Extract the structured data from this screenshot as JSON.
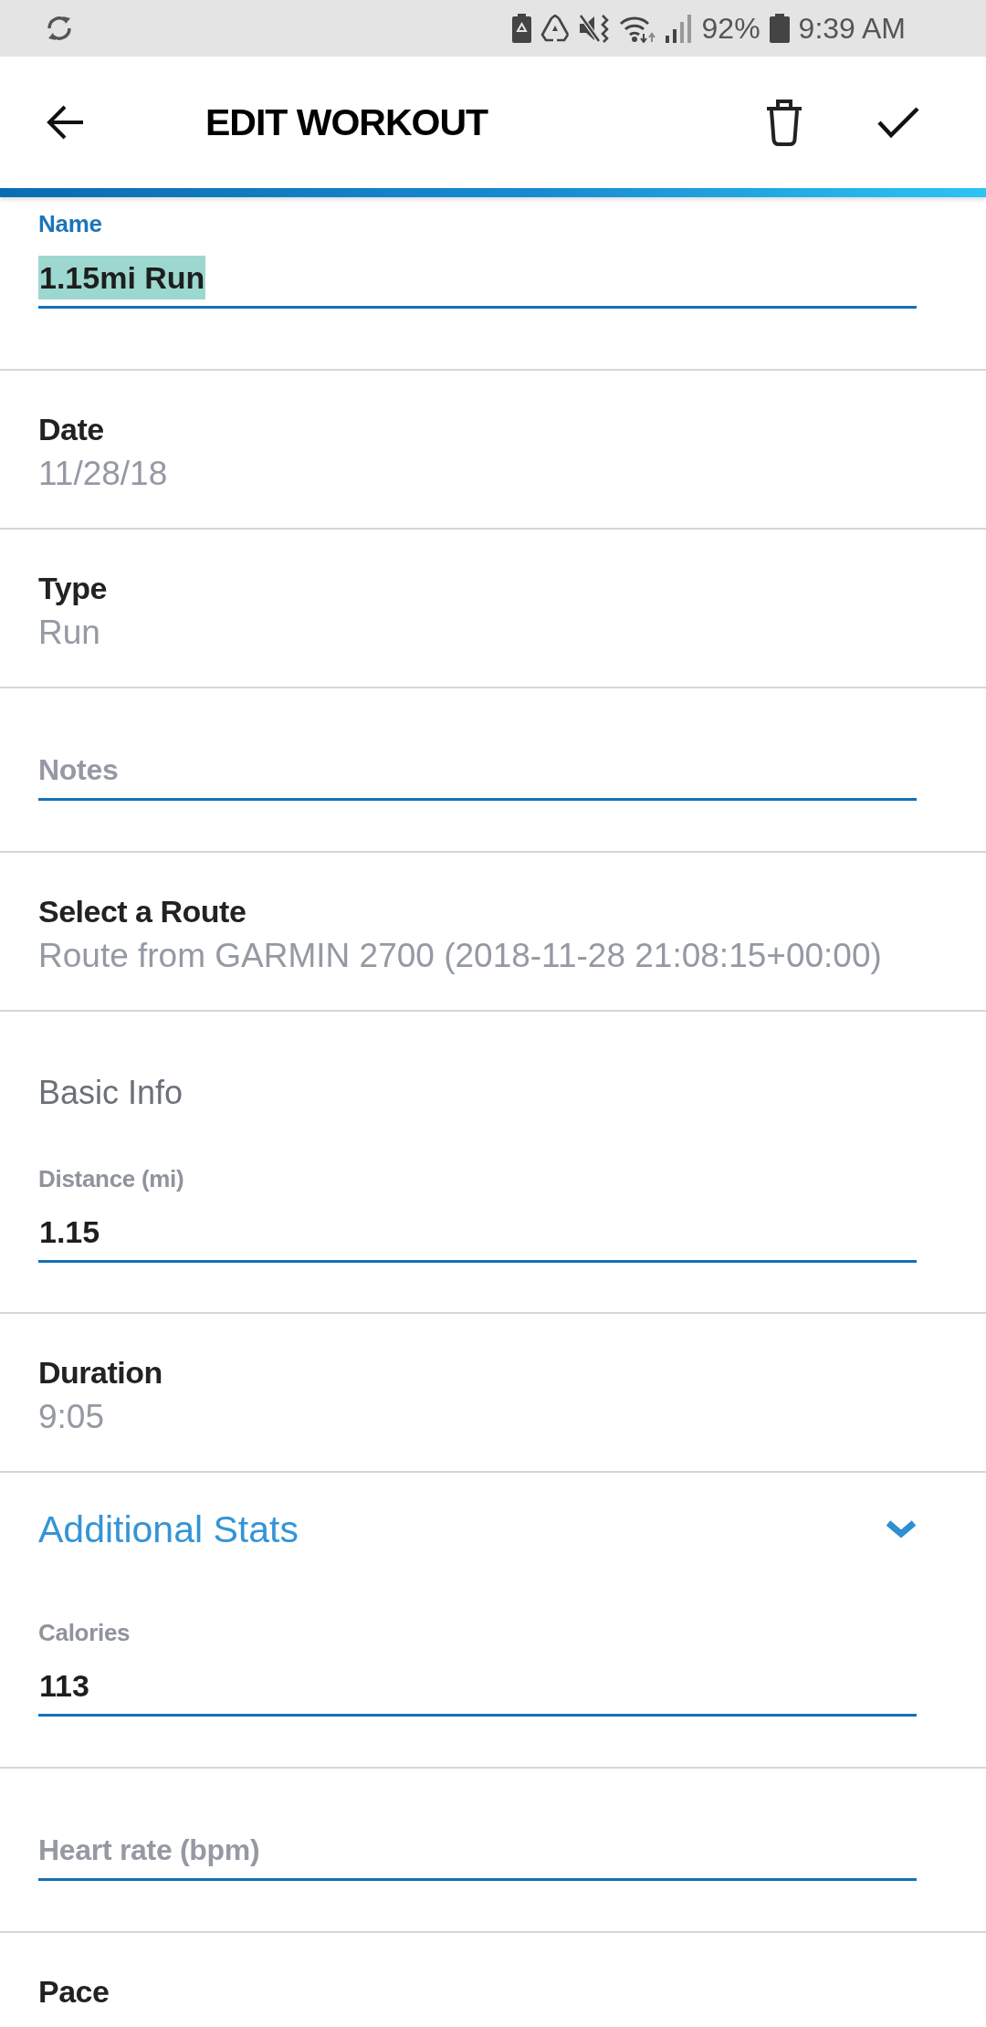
{
  "status_bar": {
    "battery": "92%",
    "time": "9:39 AM"
  },
  "header": {
    "title": "EDIT WORKOUT"
  },
  "form": [
    {
      "kind": "input",
      "label": "Name",
      "value": "1.15mi Run",
      "focused": true,
      "text_selected": true
    },
    {
      "kind": "detail",
      "label": "Date",
      "value": "11/28/18"
    },
    {
      "kind": "detail",
      "label": "Type",
      "value": "Run"
    },
    {
      "kind": "input",
      "placeholder": "Notes",
      "focused": false,
      "text_selected": false
    },
    {
      "kind": "detail",
      "label": "Select a Route",
      "value": "Route from GARMIN 2700 (2018-11-28 21:08:15+00:00)"
    },
    {
      "kind": "group",
      "title": "Basic Info",
      "fields": [
        {
          "label": "Distance (mi)",
          "value": "1.15",
          "focused": false,
          "text_selected": false
        }
      ]
    },
    {
      "kind": "detail",
      "label": "Duration",
      "value": "9:05"
    },
    {
      "kind": "expander",
      "title": "Additional Stats",
      "expanded": true,
      "fields": [
        {
          "label": "Calories",
          "value": "113",
          "focused": false,
          "text_selected": false
        }
      ]
    },
    {
      "kind": "input",
      "placeholder": "Heart rate (bpm)",
      "focused": false,
      "text_selected": false
    },
    {
      "kind": "detail",
      "label": "Pace"
    }
  ]
}
